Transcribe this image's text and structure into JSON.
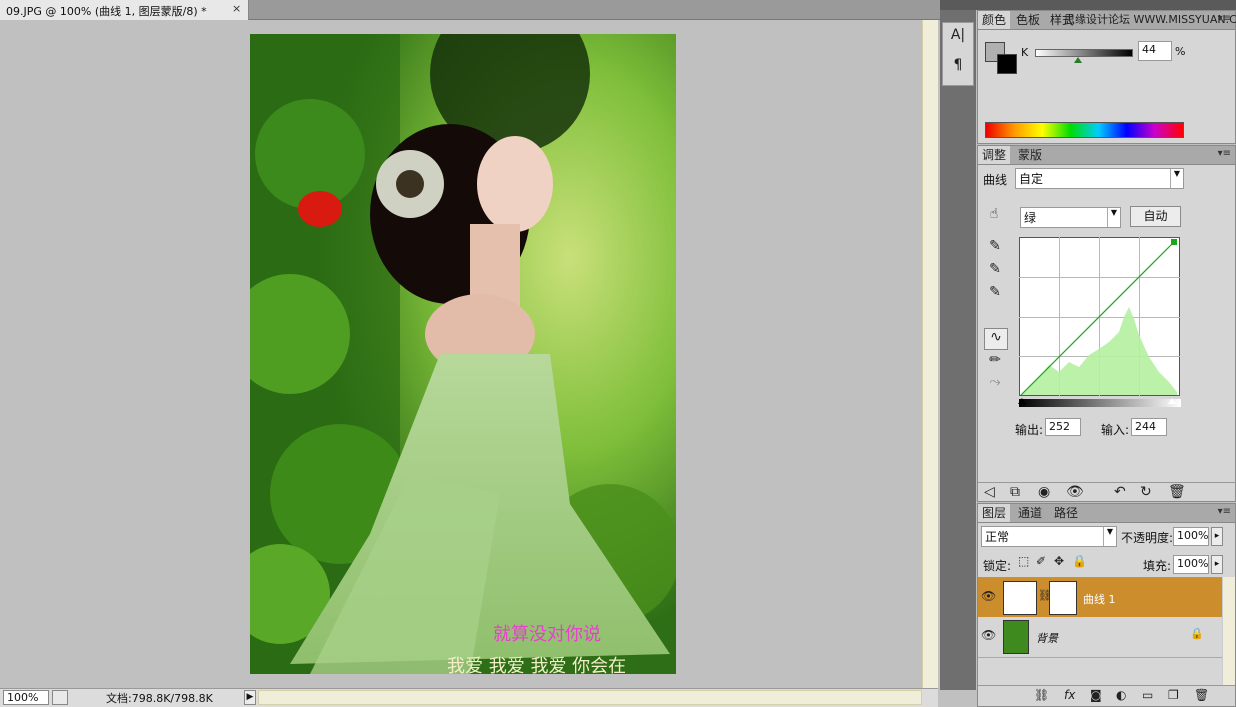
{
  "document": {
    "tab_title": "09.JPG @ 100% (曲线 1, 图层蒙版/8) *",
    "close_glyph": "×",
    "zoom": "100%",
    "doc_size": "文档:798.8K/798.8K",
    "status_arrow": "▶"
  },
  "photo": {
    "lyric_line1": "就算没对你说",
    "lyric_line2": "我爱  我爱  我爱  你会在"
  },
  "toolstrip": {
    "icons": [
      "character-icon",
      "paragraph-icon"
    ],
    "char_glyph": "A|",
    "para_glyph": "¶"
  },
  "color_panel": {
    "tabs": [
      "颜色",
      "色板",
      "样式"
    ],
    "watermark": "思缘设计论坛  WWW.MISSYUAN.COM",
    "channel_label": "K",
    "value": "44",
    "unit": "%"
  },
  "adjust_panel": {
    "tabs": [
      "调整",
      "蒙版"
    ],
    "type_label": "曲线",
    "preset": "自定",
    "channel": "绿",
    "auto_button": "自动",
    "output_label": "输出:",
    "output_value": "252",
    "input_label": "输入:",
    "input_value": "244"
  },
  "layers_panel": {
    "tabs": [
      "图层",
      "通道",
      "路径"
    ],
    "blend_mode": "正常",
    "opacity_label": "不透明度:",
    "opacity": "100%",
    "lock_label": "锁定:",
    "fill_label": "填充:",
    "fill": "100%",
    "layers": [
      {
        "name": "曲线 1",
        "selected": true
      },
      {
        "name": "背景",
        "selected": false
      }
    ],
    "bottom_icons": [
      "link-icon",
      "fx-icon",
      "mask-icon",
      "adjustment-icon",
      "group-icon",
      "new-layer-icon",
      "trash-icon"
    ],
    "fx_glyph": "fx"
  },
  "colors": {
    "accent_selected_layer": "#cc8d2c",
    "curve_channel": "#1aa51a"
  }
}
